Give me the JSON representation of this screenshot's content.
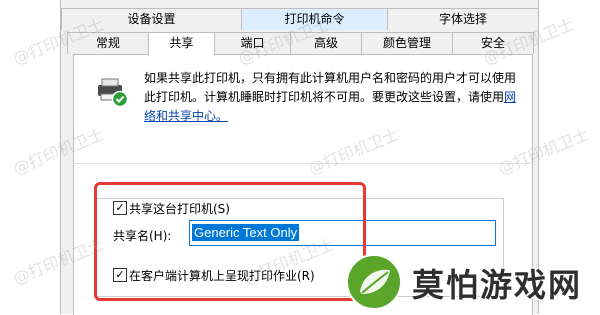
{
  "tabs_top": [
    "设备设置",
    "打印机命令",
    "字体选择"
  ],
  "tabs_bottom": [
    "常规",
    "共享",
    "端口",
    "高级",
    "颜色管理",
    "安全"
  ],
  "share_panel": {
    "description": "如果共享此打印机，只有拥有此计算机用户名和密码的用户才可以使用此打印机。计算机睡眠时打印机将不可用。要更改这些设置，请使用",
    "link_text": "网络和共享中心。",
    "share_checkbox_label": "共享这台打印机(S)",
    "share_checked": true,
    "share_name_label": "共享名(H):",
    "share_name_value": "Generic Text Only",
    "render_checkbox_label": "在客户端计算机上呈现打印作业(R)",
    "render_checked": true
  },
  "watermark_text": "@打印机卫士",
  "logo_text": "莫怕游戏网",
  "colors": {
    "tab_active": "#ffffff",
    "tab_highlight": "#ddeeff",
    "selection": "#0078d7",
    "annotation_red": "#e53935",
    "logo_green": "#5aa52a"
  }
}
